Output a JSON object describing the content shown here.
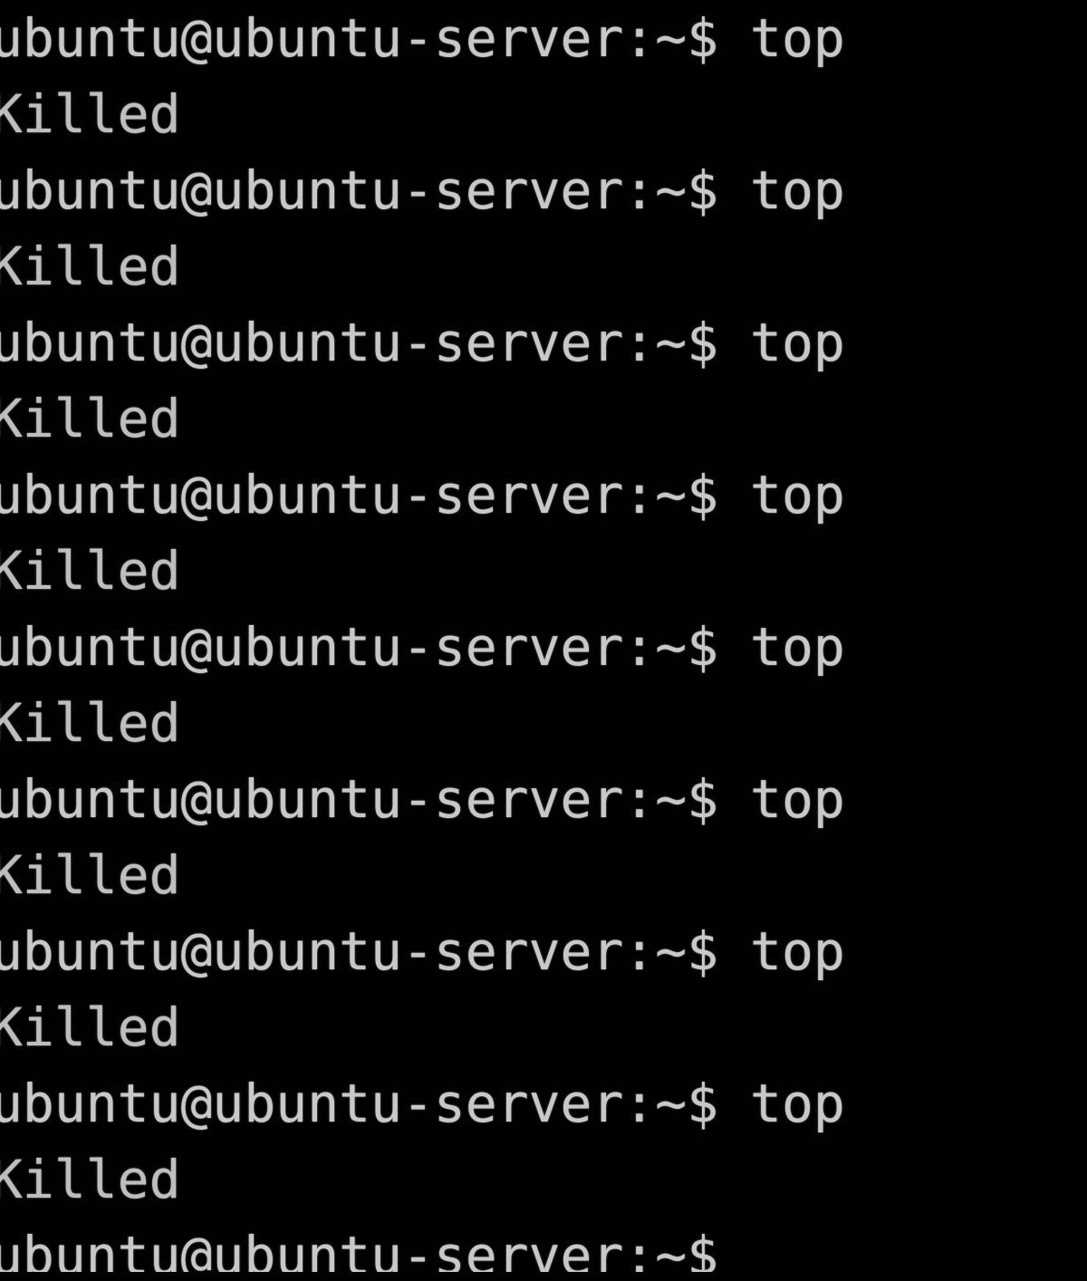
{
  "terminal": {
    "background_color": "#000000",
    "text_color": "#c2c2c2",
    "shell_user": "ubuntu",
    "shell_host": "ubuntu-server",
    "shell_cwd": "~",
    "shell_symbol": "$",
    "prompt": "ubuntu@ubuntu-server:~$",
    "command": "top",
    "prompt_with_command": "ubuntu@ubuntu-server:~$ top",
    "kill_message": "Killed",
    "lines": [
      {
        "type": "prompt",
        "text": "ubuntu@ubuntu-server:~$ top"
      },
      {
        "type": "output",
        "text": "Killed"
      },
      {
        "type": "prompt",
        "text": "ubuntu@ubuntu-server:~$ top"
      },
      {
        "type": "output",
        "text": "Killed"
      },
      {
        "type": "prompt",
        "text": "ubuntu@ubuntu-server:~$ top"
      },
      {
        "type": "output",
        "text": "Killed"
      },
      {
        "type": "prompt",
        "text": "ubuntu@ubuntu-server:~$ top"
      },
      {
        "type": "output",
        "text": "Killed"
      },
      {
        "type": "prompt",
        "text": "ubuntu@ubuntu-server:~$ top"
      },
      {
        "type": "output",
        "text": "Killed"
      },
      {
        "type": "prompt",
        "text": "ubuntu@ubuntu-server:~$ top"
      },
      {
        "type": "output",
        "text": "Killed"
      },
      {
        "type": "prompt",
        "text": "ubuntu@ubuntu-server:~$ top"
      },
      {
        "type": "output",
        "text": "Killed"
      },
      {
        "type": "prompt",
        "text": "ubuntu@ubuntu-server:~$ top"
      },
      {
        "type": "output",
        "text": "Killed"
      },
      {
        "type": "prompt",
        "text": "ubuntu@ubuntu-server:~$"
      }
    ]
  }
}
